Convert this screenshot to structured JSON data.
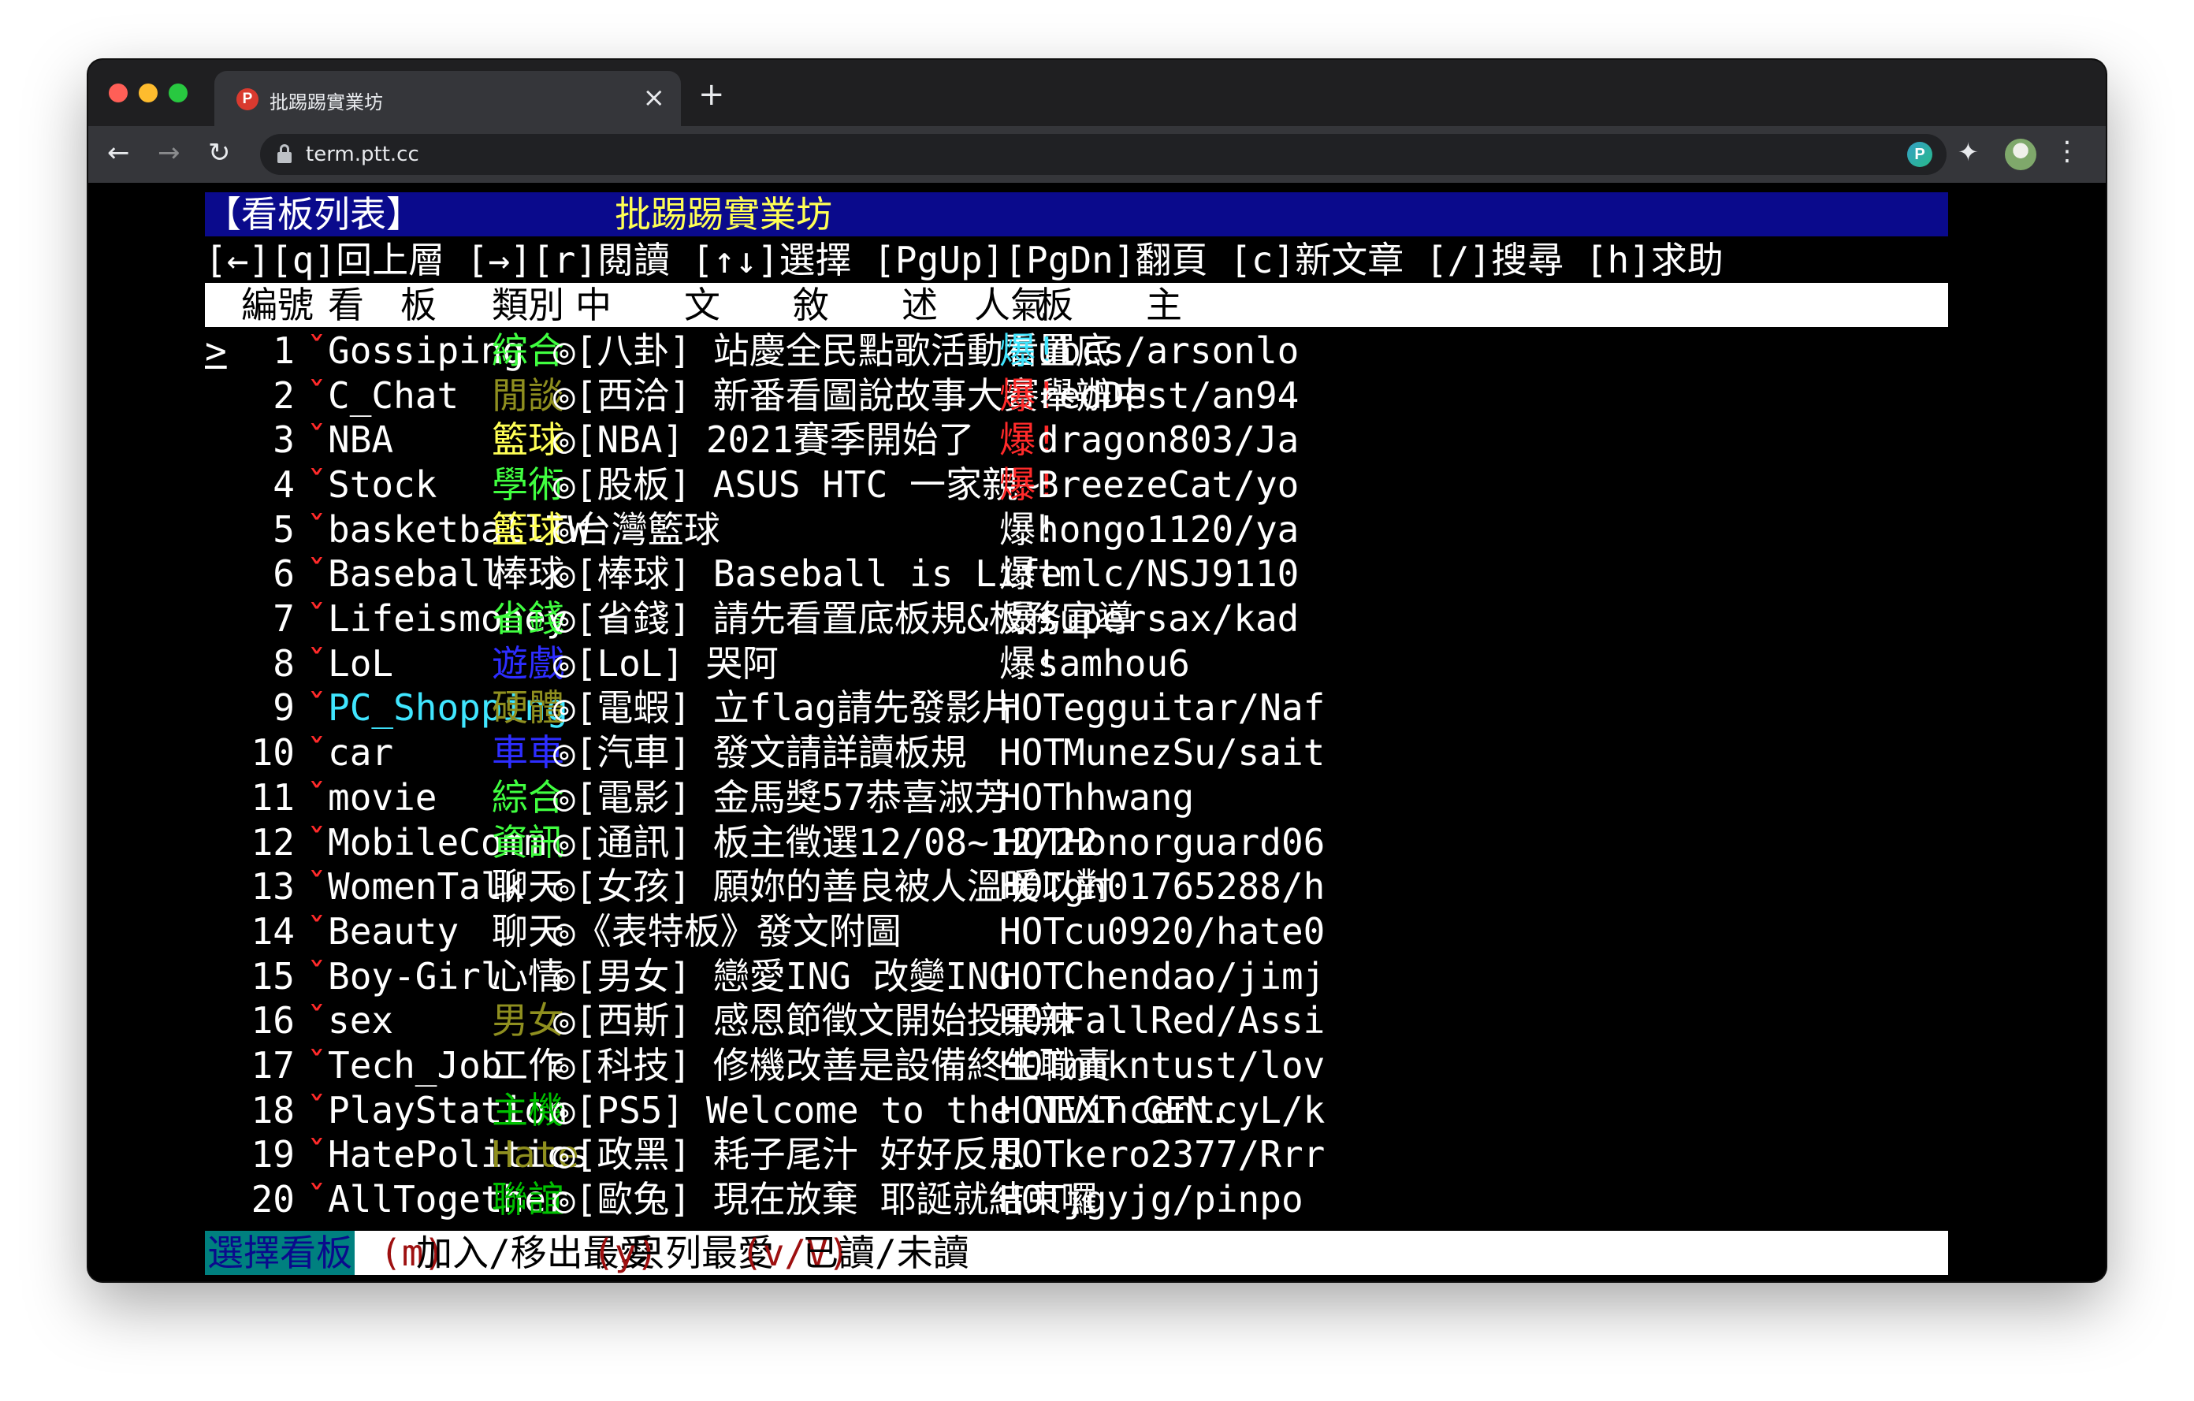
{
  "browser": {
    "tab_title": "批踢踢實業坊",
    "tab_icon": "ptt-favicon",
    "tab_favicon_letter": "P",
    "close_label": "×",
    "new_tab_label": "+",
    "url": "term.ptt.cc",
    "back_label": "←",
    "forward_label": "→",
    "reload_label": "↻",
    "star_label": "☆",
    "extension_letter": "P",
    "puzzle_label": "✦",
    "menu_label": "⋮"
  },
  "terminal": {
    "header_left": "【看板列表】",
    "header_center": "批踢踢實業坊",
    "help_line": "[←][q]回上層 [→][r]閱讀 [↑↓]選擇 [PgUp][PgDn]翻頁 [c]新文章 [/]搜尋 [h]求助",
    "columns": {
      "number": "編號",
      "board": "看　板",
      "category": "類別",
      "description": "中　　文　　敘　　述",
      "popularity": "人氣",
      "moderator": "板　　主"
    },
    "cursor": ">",
    "boards": [
      {
        "num": "1",
        "mark": "ˇ",
        "name": "Gossiping",
        "category": "綜合",
        "desc": "◎[八卦] 站慶全民點歌活動看置底",
        "hot": "爆!",
        "mod": "ubcs/arsonlo"
      },
      {
        "num": "2",
        "mark": "ˇ",
        "name": "C_Chat",
        "category": "閒談",
        "desc": "◎[西洽] 新番看圖說故事大賽舉辦中",
        "hot": "爆!",
        "mod": "redDest/an94"
      },
      {
        "num": "3",
        "mark": "ˇ",
        "name": "NBA",
        "category": "籃球",
        "desc": "◎[NBA] 2021賽季開始了",
        "hot": "爆!",
        "mod": "dragon803/Ja"
      },
      {
        "num": "4",
        "mark": "ˇ",
        "name": "Stock",
        "category": "學術",
        "desc": "◎[股板] ASUS HTC 一家親~",
        "hot": "爆!",
        "mod": "BreezeCat/yo"
      },
      {
        "num": "5",
        "mark": "ˇ",
        "name": "basketballTW",
        "category": "籃球",
        "desc": "◎台灣籃球",
        "hot": "爆!",
        "mod": "hongo1120/ya"
      },
      {
        "num": "6",
        "mark": "ˇ",
        "name": "Baseball",
        "category": "棒球",
        "desc": "◎[棒球] Baseball is Life",
        "hot": "爆!",
        "mod": "tmlc/NSJ9110"
      },
      {
        "num": "7",
        "mark": "ˇ",
        "name": "Lifeismoney",
        "category": "省錢",
        "desc": "◎[省錢] 請先看置底板規&板務宣導",
        "hot": "爆!",
        "mod": "supersax/kad"
      },
      {
        "num": "8",
        "mark": "ˇ",
        "name": "LoL",
        "category": "遊戲",
        "desc": "◎[LoL] 哭阿",
        "hot": "爆!",
        "mod": "samhou6"
      },
      {
        "num": "9",
        "mark": "ˇ",
        "name": "PC_Shopping",
        "category": "硬體",
        "desc": "◎[電蝦] 立flag請先發影片",
        "hot": "HOT",
        "mod": "egguitar/Naf"
      },
      {
        "num": "10",
        "mark": "ˇ",
        "name": "car",
        "category": "車車",
        "desc": "◎[汽車] 發文請詳讀板規",
        "hot": "HOT",
        "mod": "MunezSu/sait"
      },
      {
        "num": "11",
        "mark": "ˇ",
        "name": "movie",
        "category": "綜合",
        "desc": "◎[電影] 金馬獎57恭喜淑芳",
        "hot": "HOT",
        "mod": "hhwang"
      },
      {
        "num": "12",
        "mark": "ˇ",
        "name": "MobileComm",
        "category": "資訊",
        "desc": "◎[通訊] 板主徵選12/08~12/22",
        "hot": "HOT",
        "mod": "Honorguard06"
      },
      {
        "num": "13",
        "mark": "ˇ",
        "name": "WomenTalk",
        "category": "聊天",
        "desc": "◎[女孩] 願妳的善良被人溫暖以對",
        "hot": "HOT",
        "mod": "gn01765288/h"
      },
      {
        "num": "14",
        "mark": "ˇ",
        "name": "Beauty",
        "category": "聊天",
        "desc": "◎《表特板》發文附圖",
        "hot": "HOT",
        "mod": "cu0920/hate0"
      },
      {
        "num": "15",
        "mark": "ˇ",
        "name": "Boy-Girl",
        "category": "心情",
        "desc": "◎[男女] 戀愛ING 改變ING",
        "hot": "HOT",
        "mod": "Chendao/jimj"
      },
      {
        "num": "16",
        "mark": "ˇ",
        "name": "sex",
        "category": "男女",
        "desc": "◎[西斯] 感恩節徵文開始投票辣",
        "hot": "HOT",
        "mod": "FallRed/Assi"
      },
      {
        "num": "17",
        "mark": "ˇ",
        "name": "Tech_Job",
        "category": "工作",
        "desc": "◎[科技] 修機改善是設備終生職責",
        "hot": "HOT",
        "mod": "mmkntust/lov"
      },
      {
        "num": "18",
        "mark": "ˇ",
        "name": "PlayStation",
        "category": "主機",
        "desc": "◎[PS5] Welcome to the NEXT GEN.",
        "hot": "HOT",
        "mod": "VincentcyL/k"
      },
      {
        "num": "19",
        "mark": "ˇ",
        "name": "HatePolitics",
        "category": "Hate",
        "desc": "◎[政黑] 耗子尾汁 好好反思",
        "hot": "HOT",
        "mod": "kero2377/Rrr"
      },
      {
        "num": "20",
        "mark": "ˇ",
        "name": "AllTogether",
        "category": "聯誼",
        "desc": "◎[歐兔] 現在放棄 耶誕就結束囉",
        "hot": "HOT",
        "mod": "jgyjg/pinpo"
      }
    ],
    "footer": {
      "mode_label": "選擇看板",
      "key_m": "(m)",
      "text_m": "加入/移出最愛",
      "key_y": "(y)",
      "text_y": "只列最愛",
      "key_v": "(v/V)",
      "text_v": "已讀/未讀"
    }
  },
  "colors": {
    "header_bg": "#0a0a8c",
    "header_title": "#ffff55",
    "footer_mode_bg": "#00807f",
    "footer_key": "#9e1010",
    "unread_mark": "#ff2a2a",
    "hot_cyan": "#40e6ff",
    "hot_red": "#ff2a2a"
  }
}
